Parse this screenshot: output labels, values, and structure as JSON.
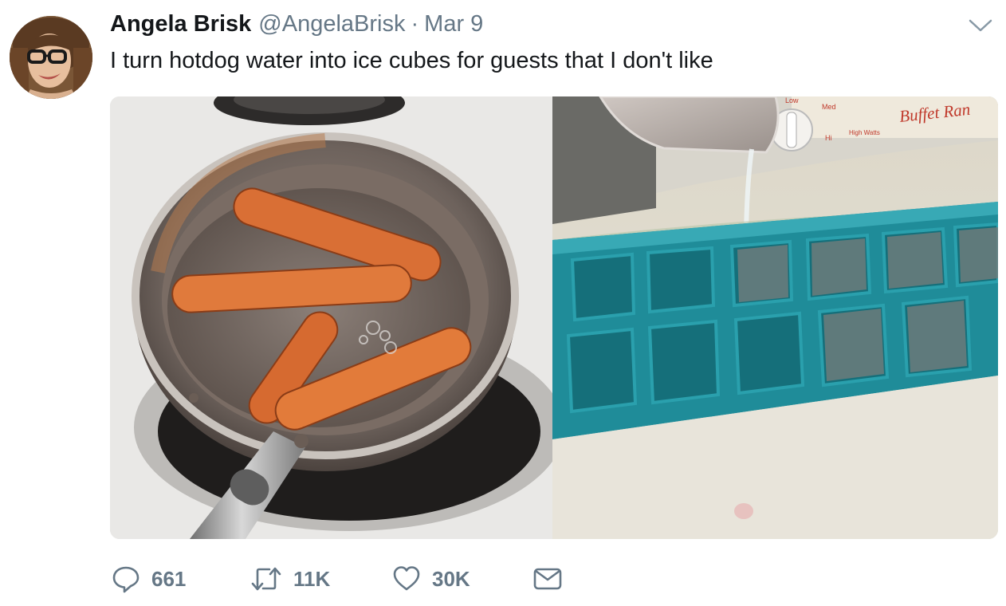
{
  "tweet": {
    "author_name": "Angela Brisk",
    "handle": "@AngelaBrisk",
    "separator": "·",
    "date": "Mar 9",
    "text": "I turn hotdog water into ice cubes for guests that I don't like",
    "photo_right_label": "Buffet Ran",
    "dial_labels": {
      "low": "Low",
      "med": "Med",
      "hi": "Hi",
      "watts": "High Watts"
    }
  },
  "actions": {
    "reply_count": "661",
    "retweet_count": "11K",
    "like_count": "30K"
  },
  "colors": {
    "text": "#14171a",
    "secondary": "#657786"
  },
  "icons": {
    "menu": "chevron-down-icon",
    "reply": "reply-icon",
    "retweet": "retweet-icon",
    "like": "heart-icon",
    "dm": "envelope-icon"
  }
}
